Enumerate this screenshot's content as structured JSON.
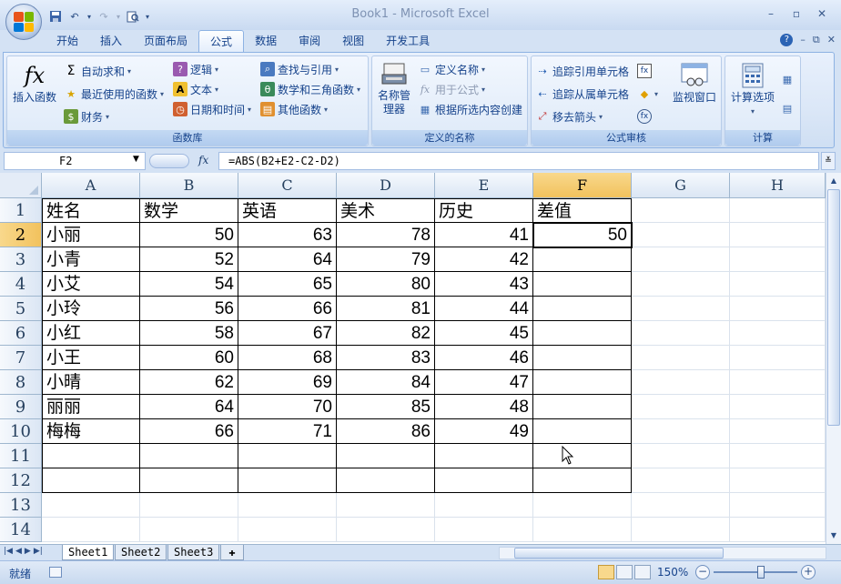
{
  "window": {
    "title": "Book1 - Microsoft Excel"
  },
  "ribbon": {
    "tabs": [
      "开始",
      "插入",
      "页面布局",
      "公式",
      "数据",
      "审阅",
      "视图",
      "开发工具"
    ],
    "active_tab": "公式",
    "groups": {
      "function_library": {
        "label": "函数库",
        "insert_function": "插入函数",
        "autosum": "自动求和",
        "recent": "最近使用的函数",
        "finance": "财务",
        "logic": "逻辑",
        "text": "文本",
        "datetime": "日期和时间",
        "lookup": "查找与引用",
        "math": "数学和三角函数",
        "other": "其他函数"
      },
      "defined_names": {
        "label": "定义的名称",
        "name_manager": "名称管理器",
        "define_name": "定义名称",
        "use_in_formula": "用于公式",
        "create_from_selection": "根据所选内容创建"
      },
      "formula_auditing": {
        "label": "公式审核",
        "trace_precedents": "追踪引用单元格",
        "trace_dependents": "追踪从属单元格",
        "remove_arrows": "移去箭头",
        "watch_window": "监视窗口"
      },
      "calculation": {
        "label": "计算",
        "calc_options": "计算选项"
      }
    }
  },
  "formula_bar": {
    "name_box": "F2",
    "fx": "fx",
    "formula": "=ABS(B2+E2-C2-D2)"
  },
  "sheet": {
    "columns": [
      "A",
      "B",
      "C",
      "D",
      "E",
      "F",
      "G",
      "H"
    ],
    "selected_column": "F",
    "selected_row": "2",
    "rows": [
      "1",
      "2",
      "3",
      "4",
      "5",
      "6",
      "7",
      "8",
      "9",
      "10",
      "11",
      "12",
      "13",
      "14"
    ],
    "header": [
      "姓名",
      "数学",
      "英语",
      "美术",
      "历史",
      "差值"
    ],
    "data": [
      [
        "小丽",
        "50",
        "63",
        "78",
        "41",
        "50"
      ],
      [
        "小青",
        "52",
        "64",
        "79",
        "42",
        ""
      ],
      [
        "小艾",
        "54",
        "65",
        "80",
        "43",
        ""
      ],
      [
        "小玲",
        "56",
        "66",
        "81",
        "44",
        ""
      ],
      [
        "小红",
        "58",
        "67",
        "82",
        "45",
        ""
      ],
      [
        "小王",
        "60",
        "68",
        "83",
        "46",
        ""
      ],
      [
        "小晴",
        "62",
        "69",
        "84",
        "47",
        ""
      ],
      [
        "丽丽",
        "64",
        "70",
        "85",
        "48",
        ""
      ],
      [
        "梅梅",
        "66",
        "71",
        "86",
        "49",
        ""
      ],
      [
        "",
        "",
        "",
        "",
        "",
        ""
      ],
      [
        "",
        "",
        "",
        "",
        "",
        ""
      ]
    ]
  },
  "sheet_tabs": [
    "Sheet1",
    "Sheet2",
    "Sheet3"
  ],
  "active_sheet": "Sheet1",
  "status": {
    "ready": "就绪",
    "zoom": "150%"
  },
  "colors": {
    "accent": "#15428b",
    "selected_header": "#f2c25d"
  }
}
